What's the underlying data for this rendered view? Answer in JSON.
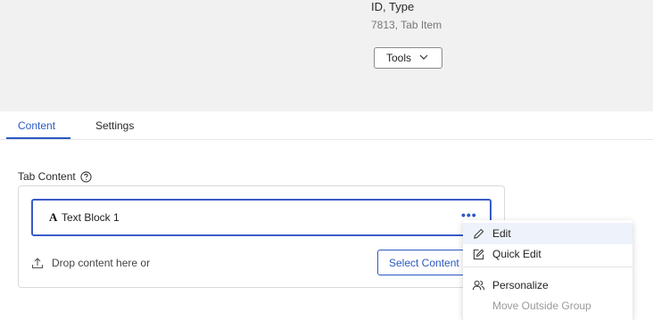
{
  "header": {
    "meta_label": "ID, Type",
    "meta_value": "7813, Tab Item",
    "tools_label": "Tools"
  },
  "tabs": [
    {
      "label": "Content",
      "active": true
    },
    {
      "label": "Settings",
      "active": false
    }
  ],
  "section": {
    "label": "Tab Content"
  },
  "content_block": {
    "type_glyph": "A",
    "title": "Text Block 1",
    "menu_glyph": "•••"
  },
  "drop_area": {
    "text": "Drop content here or",
    "select_label": "Select Content"
  },
  "context_menu": {
    "items": [
      {
        "label": "Edit",
        "icon": "pencil-icon",
        "active": true
      },
      {
        "label": "Quick Edit",
        "icon": "edit-square-icon"
      },
      {
        "label": "Personalize",
        "icon": "users-icon"
      },
      {
        "label": "Move Outside Group",
        "disabled": true
      }
    ]
  },
  "colors": {
    "accent": "#2b59c3",
    "header_bg": "#f1f1f1"
  }
}
